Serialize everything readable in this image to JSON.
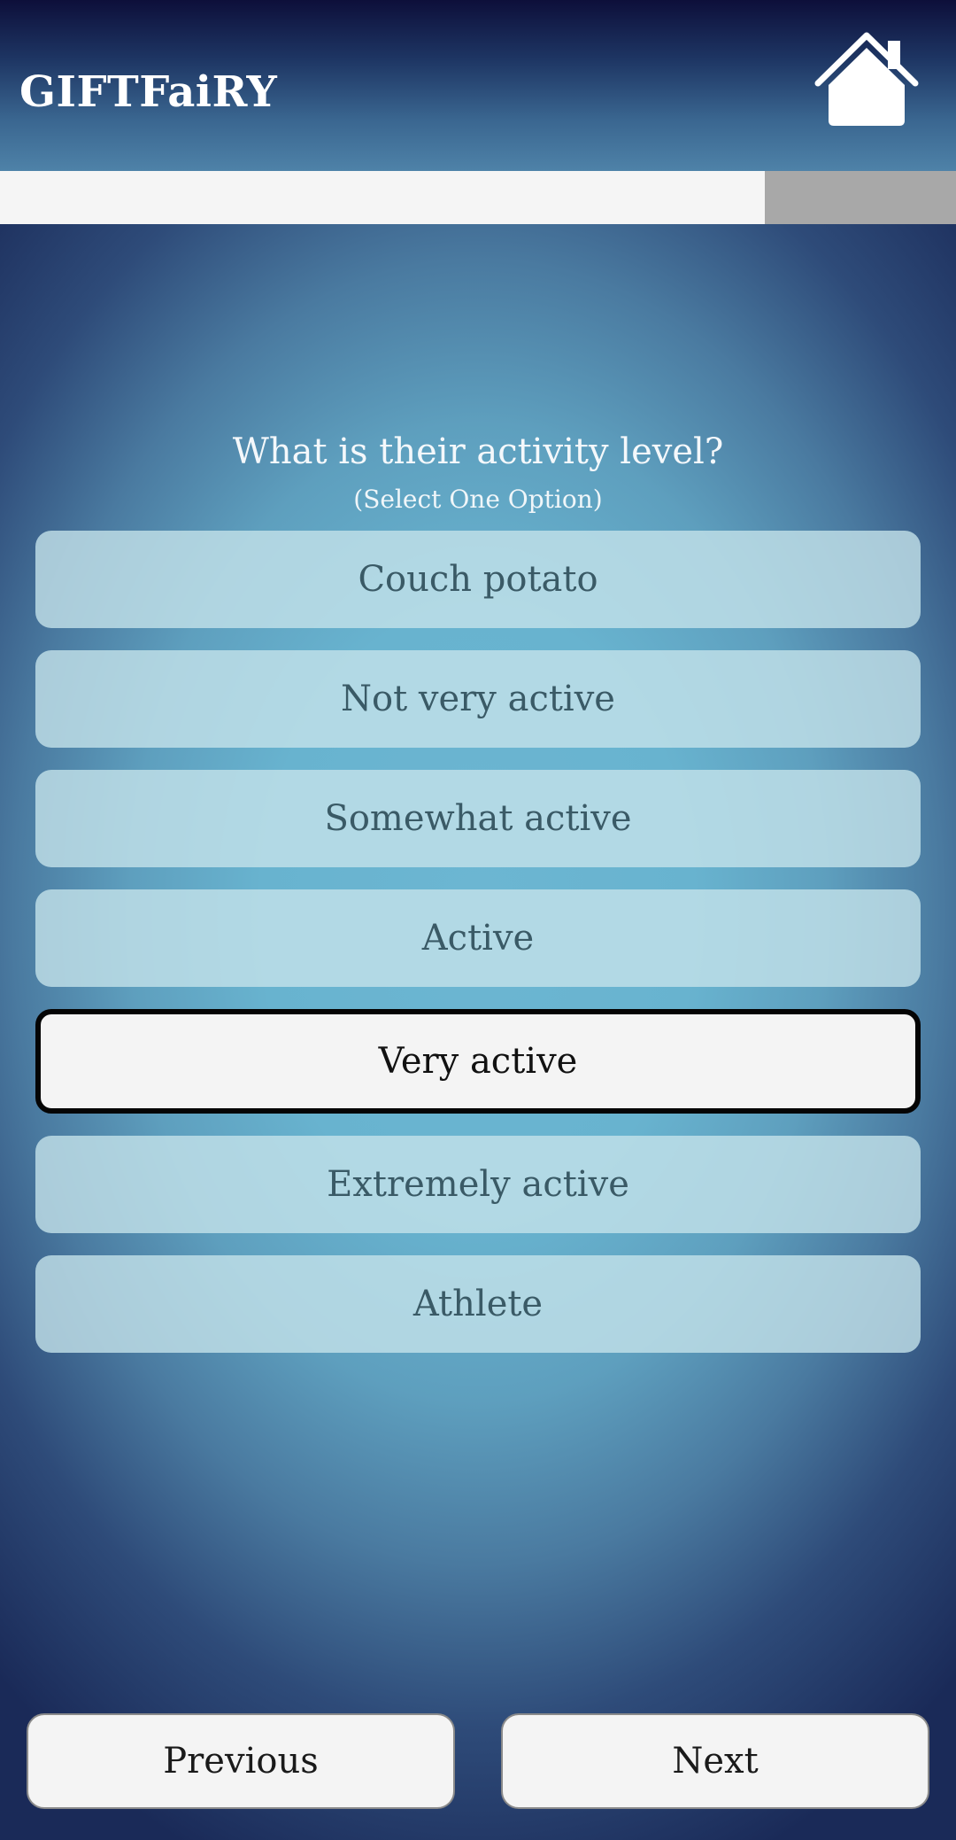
{
  "header": {
    "app_title": "GIFTFaiRY",
    "home_icon": "home-icon"
  },
  "progress": {
    "fraction": 0.8
  },
  "question": {
    "title": "What is their activity level?",
    "instruction": "(Select One Option)"
  },
  "options": [
    {
      "label": "Couch potato",
      "selected": false
    },
    {
      "label": "Not very active",
      "selected": false
    },
    {
      "label": "Somewhat active",
      "selected": false
    },
    {
      "label": "Active",
      "selected": false
    },
    {
      "label": "Very active",
      "selected": true
    },
    {
      "label": "Extremely active",
      "selected": false
    },
    {
      "label": "Athlete",
      "selected": false
    }
  ],
  "nav": {
    "previous_label": "Previous",
    "next_label": "Next"
  },
  "colors": {
    "header_top": "#0d0f3a",
    "option_bg": "#c4e2ea",
    "selected_border": "#050505",
    "button_bg": "#f4f4f4"
  }
}
